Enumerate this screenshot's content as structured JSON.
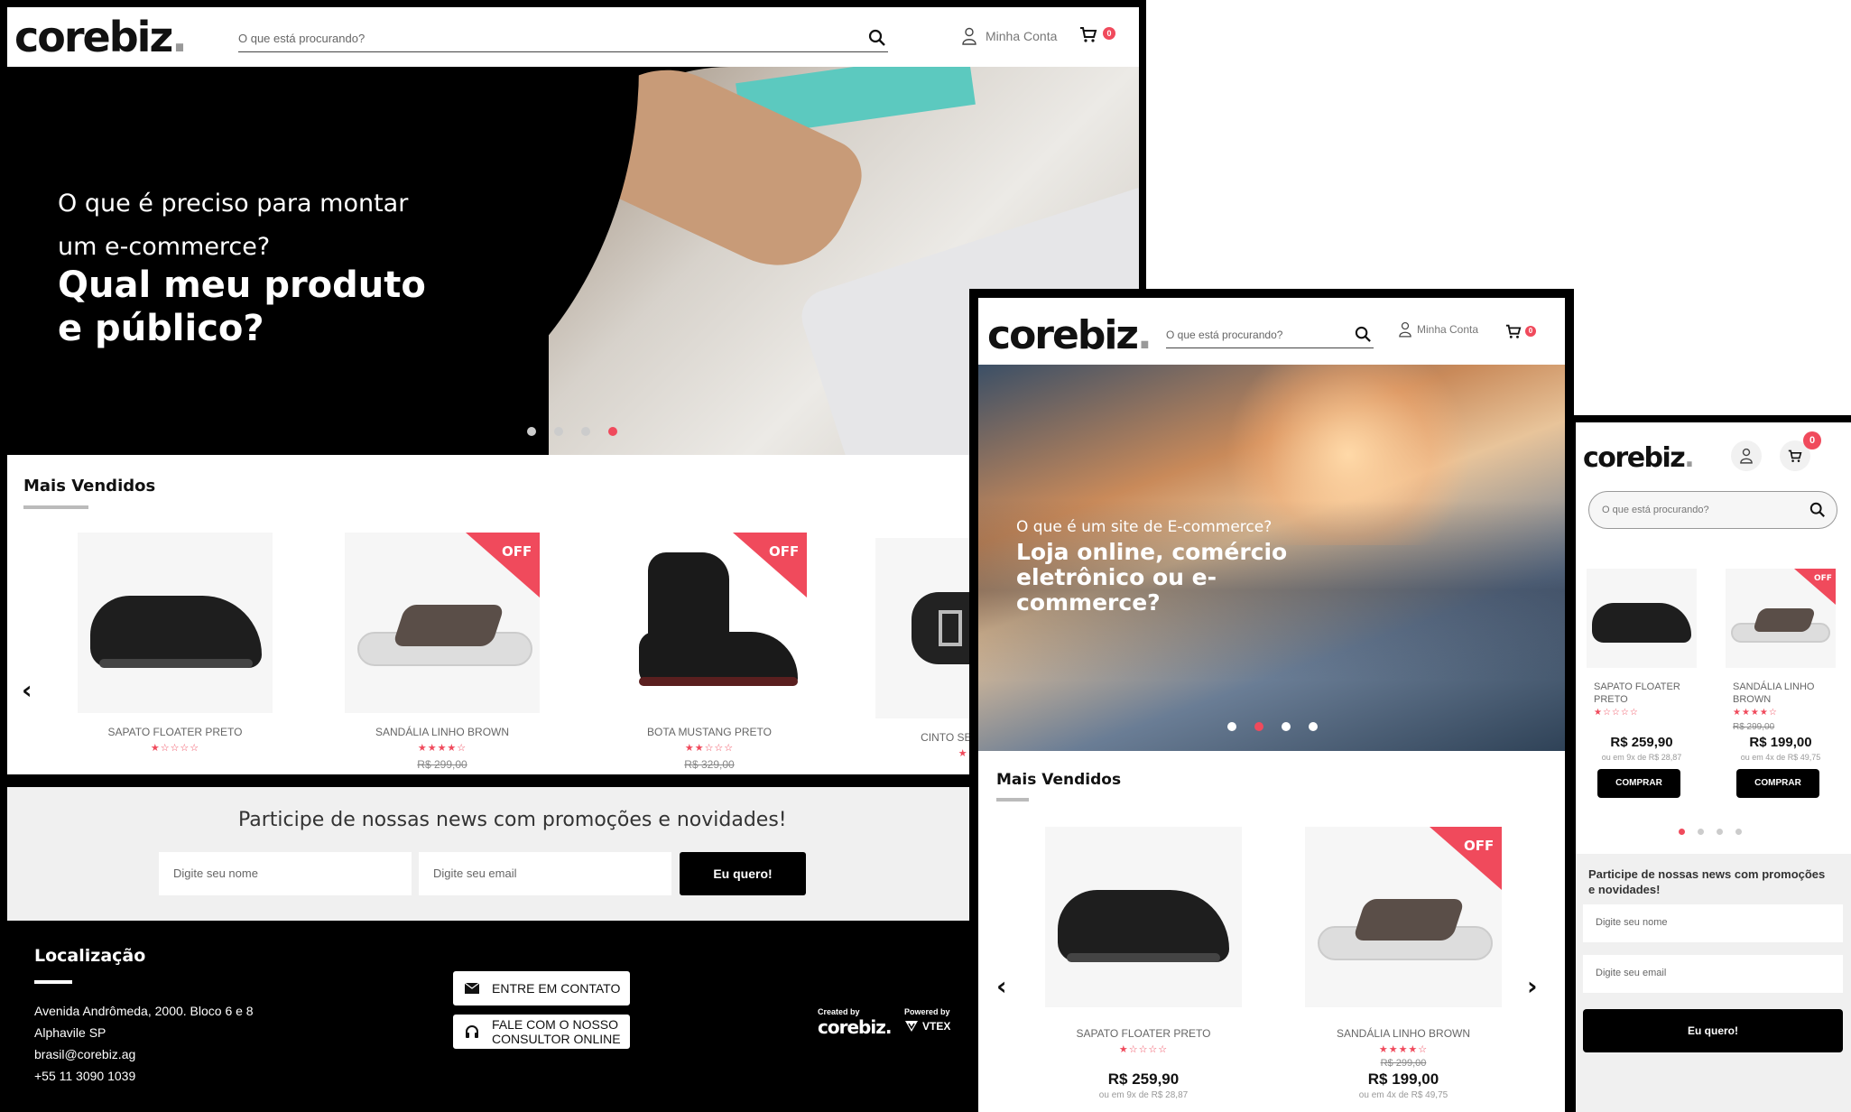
{
  "brand": {
    "logo": "corebiz",
    "accent": "#f04a5c"
  },
  "header": {
    "search_placeholder": "O que está procurando?",
    "account_label": "Minha Conta",
    "cart_count": "0"
  },
  "desktop": {
    "hero": {
      "line1": "O que é preciso para montar",
      "line2": "um e-commerce?",
      "headline1": "Qual meu produto",
      "headline2": "e público?"
    },
    "bestsellers_title": "Mais Vendidos",
    "products": [
      {
        "name": "SAPATO FLOATER PRETO",
        "stars": "★☆☆☆☆",
        "old_price": ""
      },
      {
        "name": "SANDÁLIA LINHO BROWN",
        "stars": "★★★★☆",
        "old_price": "R$ 299,00",
        "badge": "OFF"
      },
      {
        "name": "BOTA MUSTANG PRETO",
        "stars": "★★☆☆☆",
        "old_price": "R$ 329,00",
        "badge": "OFF"
      },
      {
        "name": "CINTO SEMICROMO",
        "stars": "★★★"
      }
    ],
    "newsletter": {
      "title": "Participe de nossas news com promoções e novidades!",
      "name_placeholder": "Digite seu nome",
      "email_placeholder": "Digite seu email",
      "submit": "Eu quero!"
    },
    "footer": {
      "location_title": "Localização",
      "address1": "Avenida Andrômeda, 2000. Bloco 6 e 8",
      "address2": "Alphavile SP",
      "email": "brasil@corebiz.ag",
      "phone": "+55 11 3090 1039",
      "contact_button": "ENTRE EM CONTATO",
      "consultant_button_1": "FALE COM O NOSSO",
      "consultant_button_2": "CONSULTOR ONLINE",
      "created_by": "Created by",
      "created_logo": "corebiz.",
      "powered_by": "Powered by",
      "powered_logo": "VTEX"
    }
  },
  "tablet": {
    "hero": {
      "line1": "O que é um site de E-commerce?",
      "headline1": "Loja online, comércio",
      "headline2": "eletrônico ou e-",
      "headline3": "commerce?"
    },
    "bestsellers_title": "Mais Vendidos",
    "products": [
      {
        "name": "SAPATO FLOATER PRETO",
        "stars": "★☆☆☆☆",
        "old_price": "",
        "price": "R$ 259,90",
        "installments": "ou em 9x de R$ 28,87"
      },
      {
        "name": "SANDÁLIA LINHO BROWN",
        "stars": "★★★★☆",
        "old_price": "R$ 299,00",
        "price": "R$ 199,00",
        "installments": "ou em 4x de R$ 49,75",
        "badge": "OFF"
      }
    ]
  },
  "mobile": {
    "products": [
      {
        "name_1": "SAPATO FLOATER",
        "name_2": "PRETO",
        "stars": "★☆☆☆☆",
        "old_price": "",
        "price": "R$ 259,90",
        "installments": "ou em 9x de R$ 28,87",
        "buy": "COMPRAR"
      },
      {
        "name_1": "SANDÁLIA LINHO",
        "name_2": "BROWN",
        "stars": "★★★★☆",
        "old_price": "R$ 299,00",
        "price": "R$ 199,00",
        "installments": "ou em 4x de R$ 49,75",
        "buy": "COMPRAR",
        "badge": "OFF"
      }
    ],
    "newsletter": {
      "title1": "Participe de nossas news com promoções",
      "title2": "e novidades!",
      "name_placeholder": "Digite seu nome",
      "email_placeholder": "Digite seu email",
      "submit": "Eu quero!"
    }
  }
}
